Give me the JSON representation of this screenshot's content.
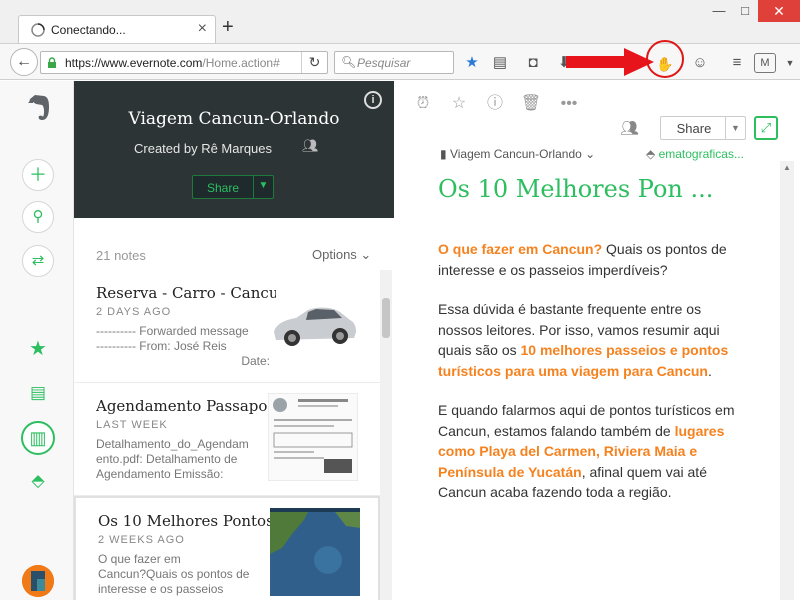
{
  "browser": {
    "tab_title": "Conectando...",
    "new_tab_label": "+",
    "url_domain": "https://www.evernote.com",
    "url_path": "/Home.action#",
    "search_placeholder": "Pesquisar",
    "window_minimize": "—",
    "window_maximize": "□",
    "window_close": "✕"
  },
  "notebook": {
    "title": "Viagem Cancun-Orlando",
    "created_by": "Created by Rê Marques",
    "share_label": "Share",
    "info_label": "i",
    "note_count": "21 notes",
    "options_label": "Options"
  },
  "notes": [
    {
      "title": "Reserva - Carro - Cancun",
      "date": "2 DAYS AGO",
      "snippet_lines": [
        "---------- Forwarded message",
        "---------- From: José Reis",
        "Date:"
      ]
    },
    {
      "title": "Agendamento Passapo...",
      "date": "LAST WEEK",
      "snippet_lines": [
        "Detalhamento_do_Agendam",
        "ento.pdf: Detalhamento de",
        "Agendamento Emissão:"
      ]
    },
    {
      "title": "Os 10 Melhores Pontos ...",
      "date": "2 WEEKS AGO",
      "snippet_lines": [
        "O que fazer em",
        "Cancun?Quais os pontos de",
        "interesse e os passeios"
      ]
    }
  ],
  "editor": {
    "share_label": "Share",
    "notebook_name": "Viagem Cancun-Orlando",
    "tag_text": "ematograficas...",
    "title": "Os 10 Melhores Pon ...",
    "p1_orange": "O que fazer em Cancun?",
    "p1_rest": " Quais os pontos de interesse e os passeios imperdíveis?",
    "p2_start": "Essa dúvida é bastante frequente entre os nossos leitores. Por isso, vamos resumir aqui quais são os ",
    "p2_orange": "10 melhores passeios e pontos turísticos para uma viagem para Cancun",
    "p2_end": ".",
    "p3_start": "E quando falarmos aqui de pontos turísticos em Cancun, estamos falando também de ",
    "p3_orange": "lugares como Playa del Carmen, Riviera Maia e Península de Yucatán",
    "p3_end": ", afinal quem vai até Cancun acaba fazendo toda a região."
  },
  "colors": {
    "accent": "#2dbe60",
    "highlight": "#f5821f",
    "notebook_header": "#2d3436",
    "annotation_red": "#e01515"
  }
}
